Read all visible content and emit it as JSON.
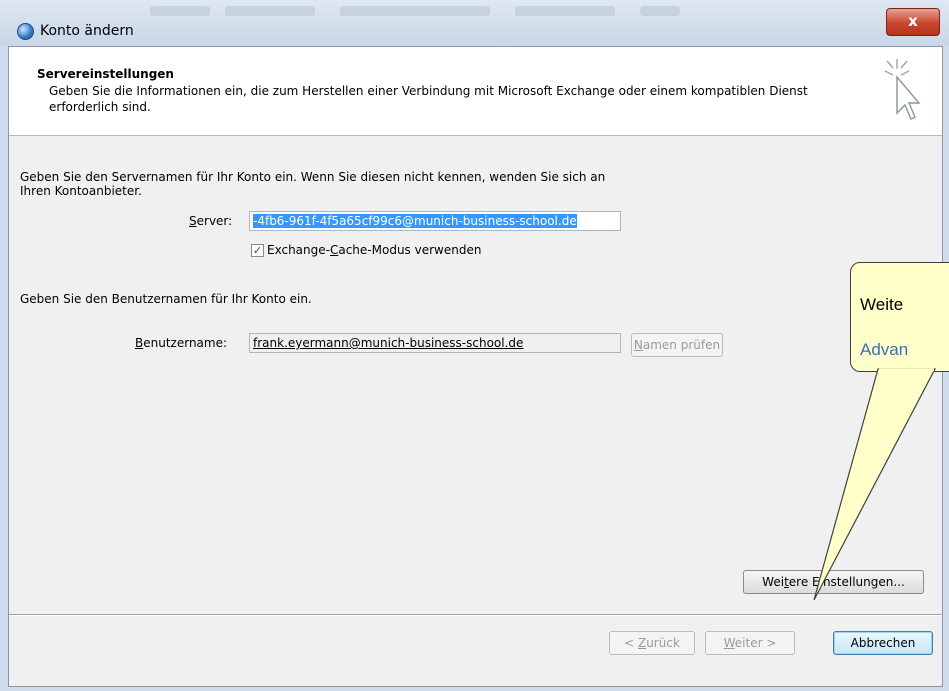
{
  "window": {
    "title": "Konto ändern",
    "close_label": "x"
  },
  "header": {
    "title": "Servereinstellungen",
    "description": "Geben Sie die Informationen ein, die zum Herstellen einer Verbindung mit Microsoft Exchange oder einem kompatiblen Dienst erforderlich sind."
  },
  "server_section": {
    "instruction": "Geben Sie den Servernamen für Ihr Konto ein. Wenn Sie diesen nicht kennen, wenden Sie sich an Ihren Kontoanbieter.",
    "server_label_pre": "",
    "server_label_u": "S",
    "server_label_post": "erver:",
    "server_value": "-4fb6-961f-4f5a65cf99c6@munich-business-school.de",
    "cache_label_pre": "Exchange-",
    "cache_label_u": "C",
    "cache_label_post": "ache-Modus verwenden",
    "cache_checked": "✓"
  },
  "user_section": {
    "instruction": "Geben Sie den Benutzernamen für Ihr Konto ein.",
    "user_label_u": "B",
    "user_label_post": "enutzername:",
    "user_value": "frank.eyermann@munich-business-school.de",
    "check_names_u": "N",
    "check_names_post": "amen prüfen"
  },
  "more_settings": {
    "pre": "Wei",
    "u": "t",
    "post": "ere Einstellungen..."
  },
  "footer": {
    "back_pre": "< ",
    "back_u": "Z",
    "back_post": "urück",
    "next_u": "W",
    "next_post": "eiter >",
    "cancel": "Abbrechen"
  },
  "callout": {
    "line1": "Weite",
    "line2": "Advan",
    "bg_color": "#ffffc9",
    "link_color": "#3a6fb6"
  }
}
